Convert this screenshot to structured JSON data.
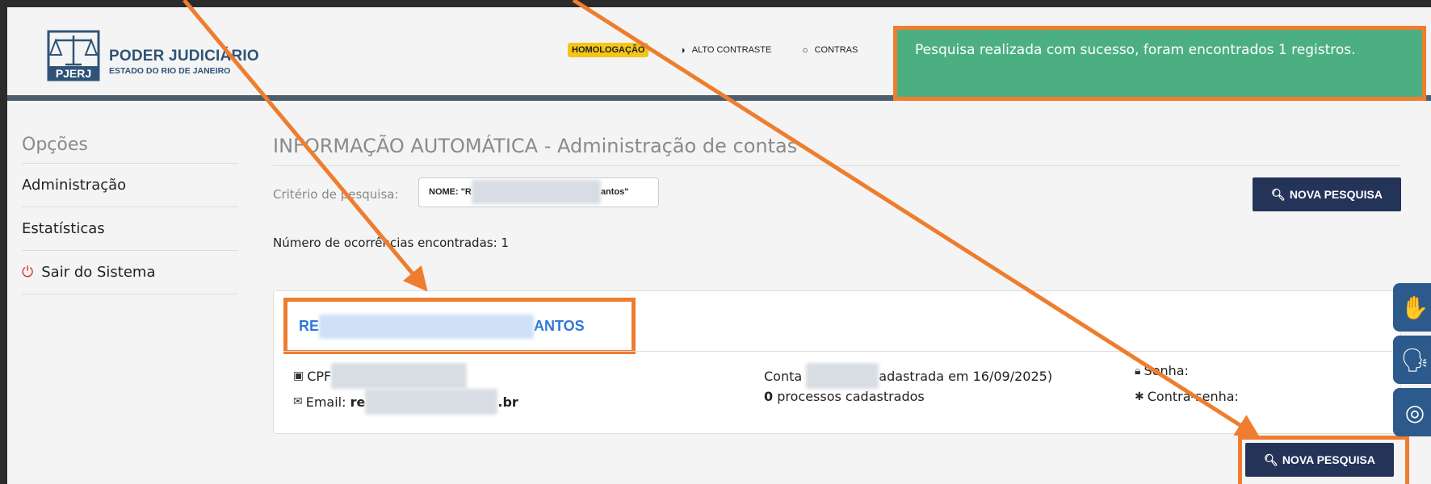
{
  "header": {
    "logo_title": "PODER JUDICIÁRIO",
    "logo_subtitle": "ESTADO DO RIO DE JANEIRO",
    "logo_mark_text": "PJERJ",
    "env_badge": "HOMOLOGAÇÃO",
    "links": [
      {
        "label": "ALTO CONTRASTE",
        "icon": "half-circle-icon"
      },
      {
        "label": "CONTRAS",
        "icon": "circle-outline-icon"
      }
    ]
  },
  "toast": {
    "message": "Pesquisa realizada com sucesso, foram encontrados 1 registros."
  },
  "sidebar": {
    "title": "Opções",
    "items": [
      {
        "label": "Administração"
      },
      {
        "label": "Estatísticas"
      },
      {
        "label": "Sair do Sistema",
        "icon": "power-icon"
      }
    ]
  },
  "main": {
    "title": "INFORMAÇÃO AUTOMÁTICA - Administração de contas",
    "criteria_label": "Critério de pesquisa:",
    "criteria_prefix": "NOME: \"R",
    "criteria_suffix": "antos\"",
    "nova_pesquisa_label": "NOVA PESQUISA",
    "count_line": "Número de ocorrências encontradas: 1",
    "result": {
      "name_prefix": "RE",
      "name_suffix": "ANTOS",
      "cpf_label": "CPF",
      "email_label": "Email:",
      "email_prefix": "re",
      "email_suffix": ".br",
      "conta_label": "Conta",
      "conta_suffix": "adastrada em 16/09/2025)",
      "processos_count": "0",
      "processos_label": "processos cadastrados",
      "senha_label": "Senha:",
      "contra_senha_label": "Contra-senha:"
    }
  },
  "colors": {
    "accent_navy": "#243358",
    "toast_green": "#4caf82",
    "highlight_orange": "#ee7d2f",
    "link_blue": "#2f78d6"
  }
}
